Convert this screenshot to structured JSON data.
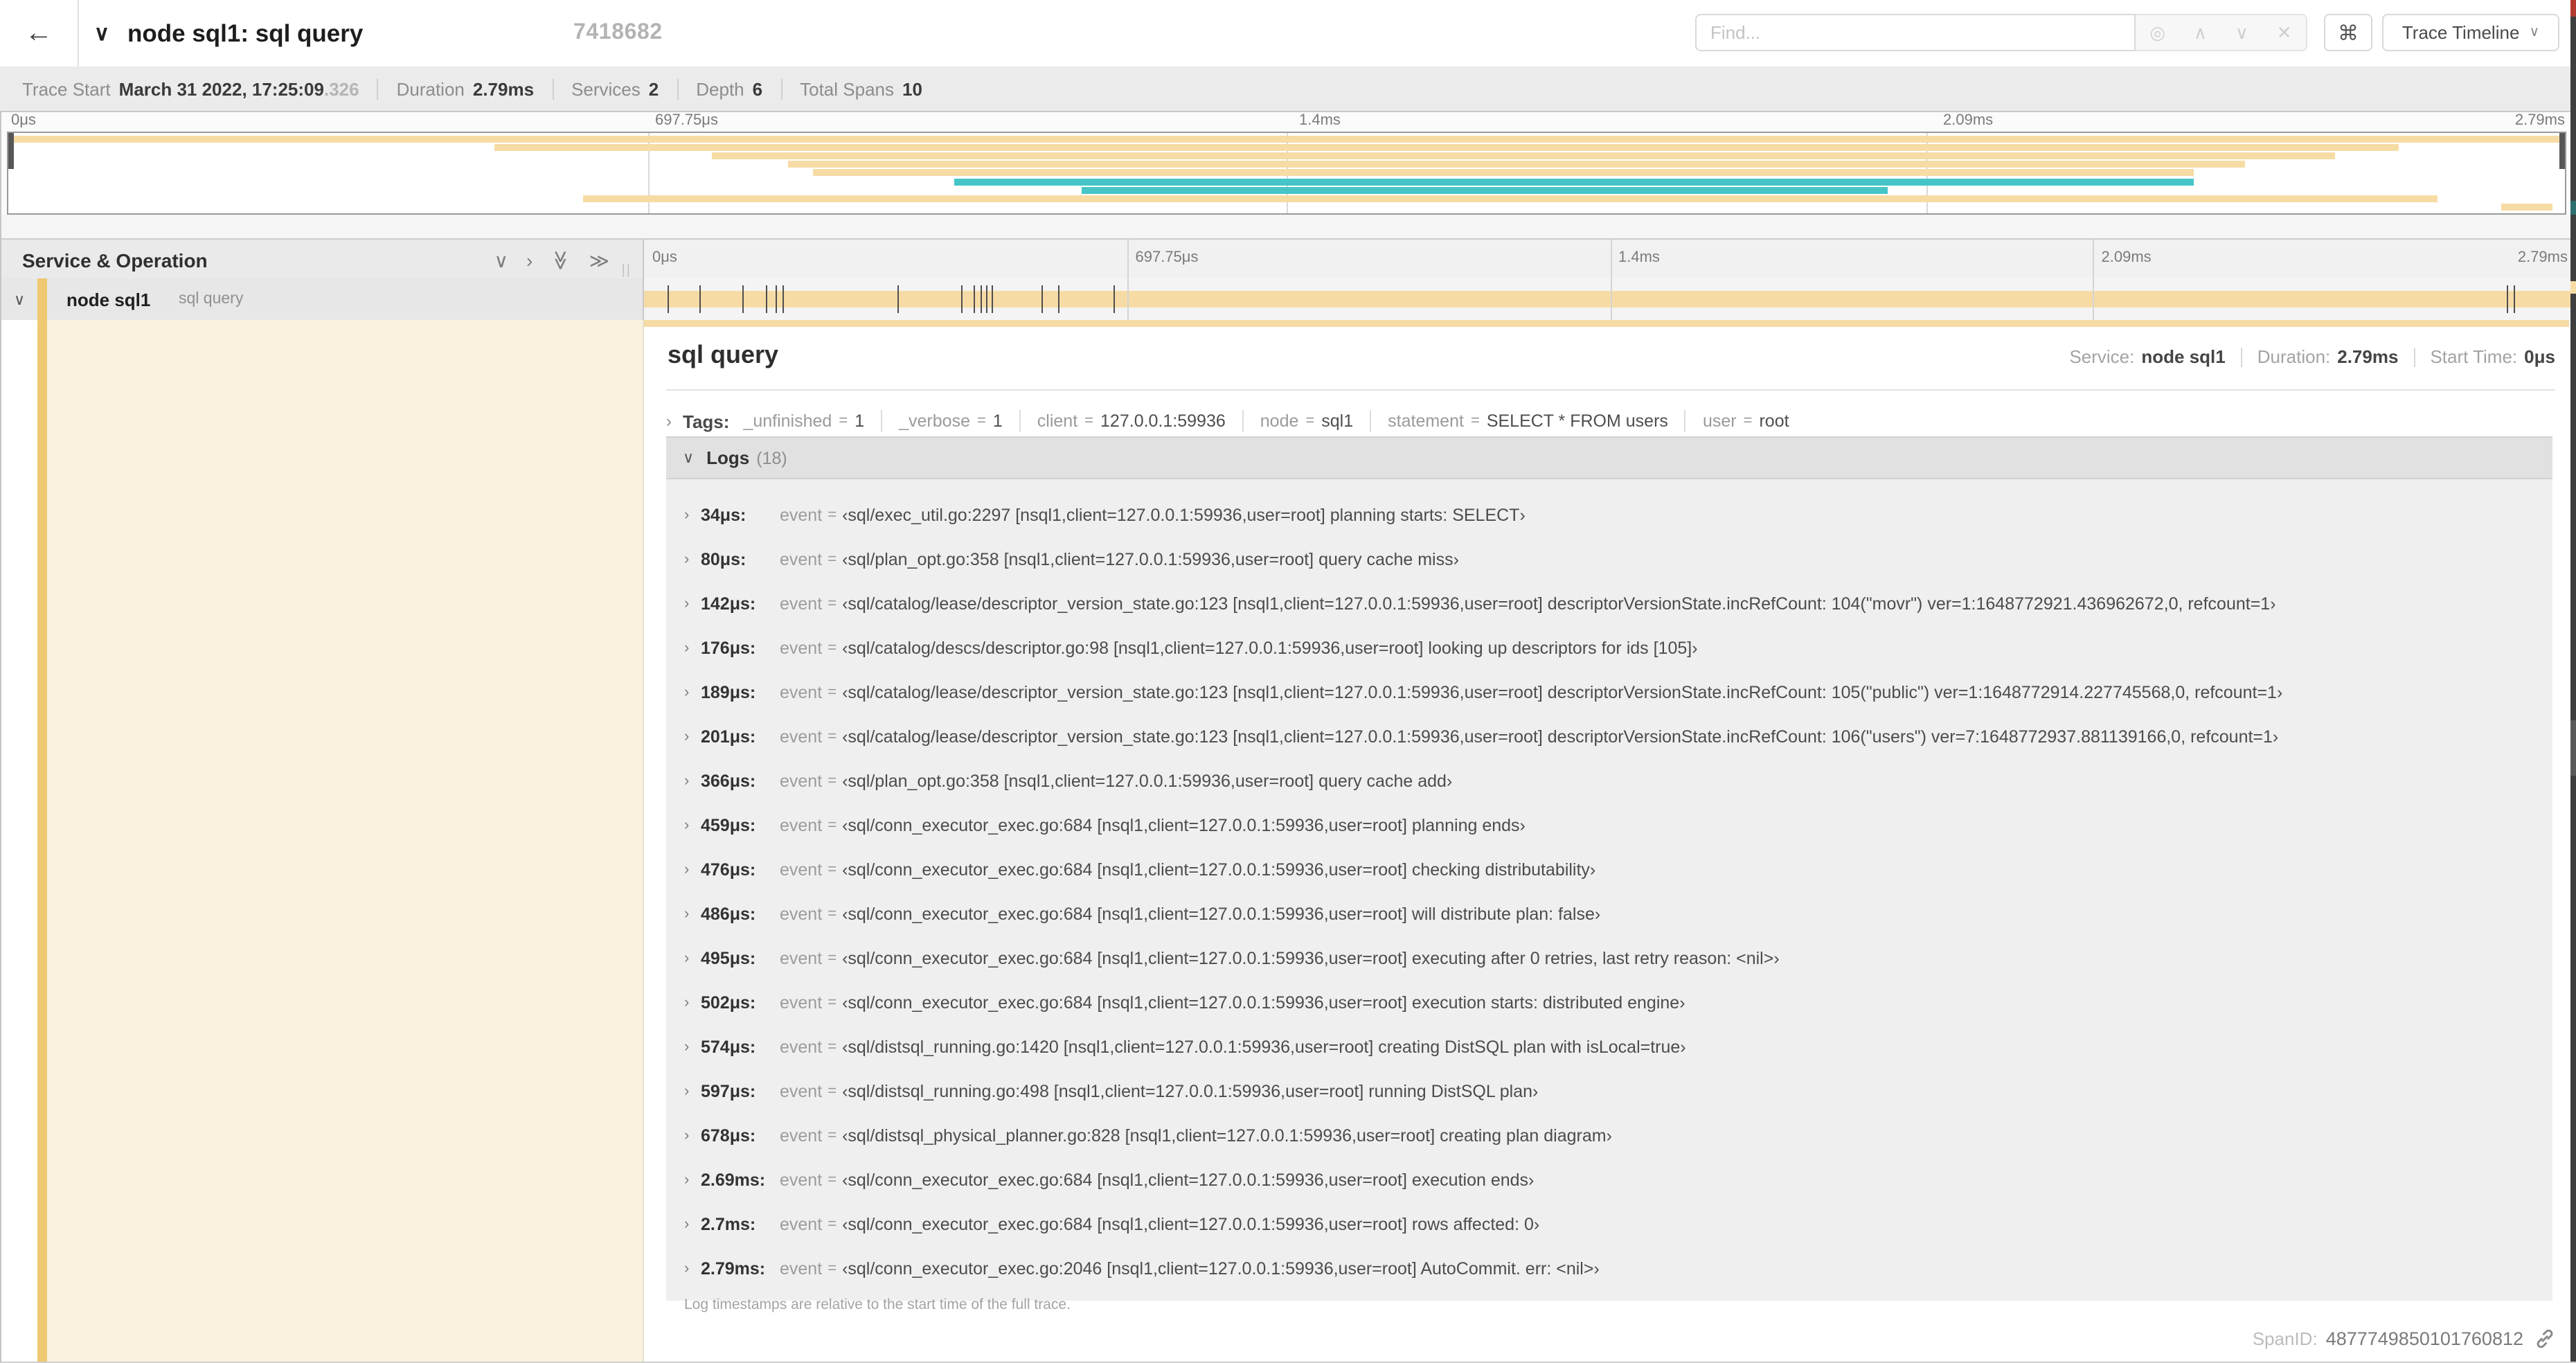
{
  "palette": {
    "span_color": "#F6DCA4",
    "span_alt_color": "#46C5C7",
    "accent_strip": "#EFC873",
    "detail_left_bg": "#FAF2DF"
  },
  "header": {
    "back_arrow": "←",
    "collapse_chevron": "∨",
    "title": "node sql1: sql query",
    "trace_id": "7418682",
    "find_placeholder": "Find...",
    "find_icons": [
      "◎",
      "∧",
      "∨",
      "✕"
    ],
    "shortcut_key": "⌘",
    "view_select_label": "Trace Timeline",
    "view_select_caret": "∨"
  },
  "summary": {
    "items": [
      {
        "label": "Trace Start",
        "value": "March 31 2022, 17:25:09",
        "suffix": ".326"
      },
      {
        "label": "Duration",
        "value": "2.79ms"
      },
      {
        "label": "Services",
        "value": "2"
      },
      {
        "label": "Depth",
        "value": "6"
      },
      {
        "label": "Total Spans",
        "value": "10"
      }
    ]
  },
  "minimap": {
    "bars": [
      {
        "start": 0.1,
        "end": 99.9,
        "color": "tan"
      },
      {
        "start": 19,
        "end": 93.5,
        "color": "tan"
      },
      {
        "start": 27.5,
        "end": 91,
        "color": "tan"
      },
      {
        "start": 30.5,
        "end": 87.5,
        "color": "tan"
      },
      {
        "start": 31.5,
        "end": 85.5,
        "color": "tan"
      },
      {
        "start": 37,
        "end": 85.5,
        "color": "teal"
      },
      {
        "start": 42,
        "end": 73.5,
        "color": "teal"
      },
      {
        "start": 22.5,
        "end": 95,
        "color": "tan"
      },
      {
        "start": 97.5,
        "end": 99.5,
        "color": "tan"
      }
    ]
  },
  "timeline": {
    "ticks": [
      {
        "label": "0μs",
        "pos": 0
      },
      {
        "label": "697.75μs",
        "pos": 25
      },
      {
        "label": "1.4ms",
        "pos": 50
      },
      {
        "label": "2.09ms",
        "pos": 75
      },
      {
        "label": "2.79ms",
        "pos": 100
      }
    ],
    "col_header": "Service & Operation",
    "controls": {
      "collapse_one": "∨",
      "expand_one": "›",
      "collapse_all": "≫",
      "expand_all": "≫",
      "resizer": "||"
    },
    "row": {
      "chevron": "∨",
      "service": "node sql1",
      "operation": "sql query",
      "marker_percents": [
        1.22,
        2.87,
        5.09,
        6.31,
        6.78,
        7.2,
        13.12,
        16.45,
        17.06,
        17.42,
        17.74,
        18.0,
        20.57,
        21.4,
        24.3,
        96.4,
        96.8,
        99.8
      ]
    }
  },
  "detail": {
    "title": "sql query",
    "service_label": "Service:",
    "service": "node sql1",
    "duration_label": "Duration:",
    "duration": "2.79ms",
    "start_label": "Start Time:",
    "start": "0μs",
    "tags_chevron": "›",
    "tags_label": "Tags:",
    "tags": [
      {
        "key": "_unfinished",
        "value": "1"
      },
      {
        "key": "_verbose",
        "value": "1"
      },
      {
        "key": "client",
        "value": "127.0.0.1:59936"
      },
      {
        "key": "node",
        "value": "sql1"
      },
      {
        "key": "statement",
        "value": "SELECT * FROM users"
      },
      {
        "key": "user",
        "value": "root"
      }
    ],
    "logs_chevron": "∨",
    "logs_label": "Logs",
    "logs_count": "(18)",
    "log_chevron": "›",
    "log_field_label": "event",
    "log_eq": "=",
    "logs": [
      {
        "time": "34μs:",
        "value": "‹sql/exec_util.go:2297 [nsql1,client=127.0.0.1:59936,user=root] planning starts: SELECT›"
      },
      {
        "time": "80μs:",
        "value": "‹sql/plan_opt.go:358 [nsql1,client=127.0.0.1:59936,user=root] query cache miss›"
      },
      {
        "time": "142μs:",
        "value": "‹sql/catalog/lease/descriptor_version_state.go:123 [nsql1,client=127.0.0.1:59936,user=root] descriptorVersionState.incRefCount: 104(\"movr\") ver=1:1648772921.436962672,0, refcount=1›"
      },
      {
        "time": "176μs:",
        "value": "‹sql/catalog/descs/descriptor.go:98 [nsql1,client=127.0.0.1:59936,user=root] looking up descriptors for ids [105]›"
      },
      {
        "time": "189μs:",
        "value": "‹sql/catalog/lease/descriptor_version_state.go:123 [nsql1,client=127.0.0.1:59936,user=root] descriptorVersionState.incRefCount: 105(\"public\") ver=1:1648772914.227745568,0, refcount=1›"
      },
      {
        "time": "201μs:",
        "value": "‹sql/catalog/lease/descriptor_version_state.go:123 [nsql1,client=127.0.0.1:59936,user=root] descriptorVersionState.incRefCount: 106(\"users\") ver=7:1648772937.881139166,0, refcount=1›"
      },
      {
        "time": "366μs:",
        "value": "‹sql/plan_opt.go:358 [nsql1,client=127.0.0.1:59936,user=root] query cache add›"
      },
      {
        "time": "459μs:",
        "value": "‹sql/conn_executor_exec.go:684 [nsql1,client=127.0.0.1:59936,user=root] planning ends›"
      },
      {
        "time": "476μs:",
        "value": "‹sql/conn_executor_exec.go:684 [nsql1,client=127.0.0.1:59936,user=root] checking distributability›"
      },
      {
        "time": "486μs:",
        "value": "‹sql/conn_executor_exec.go:684 [nsql1,client=127.0.0.1:59936,user=root] will distribute plan: false›"
      },
      {
        "time": "495μs:",
        "value": "‹sql/conn_executor_exec.go:684 [nsql1,client=127.0.0.1:59936,user=root] executing after 0 retries, last retry reason: <nil>›"
      },
      {
        "time": "502μs:",
        "value": "‹sql/conn_executor_exec.go:684 [nsql1,client=127.0.0.1:59936,user=root] execution starts: distributed engine›"
      },
      {
        "time": "574μs:",
        "value": "‹sql/distsql_running.go:1420 [nsql1,client=127.0.0.1:59936,user=root] creating DistSQL plan with isLocal=true›"
      },
      {
        "time": "597μs:",
        "value": "‹sql/distsql_running.go:498 [nsql1,client=127.0.0.1:59936,user=root] running DistSQL plan›"
      },
      {
        "time": "678μs:",
        "value": "‹sql/distsql_physical_planner.go:828 [nsql1,client=127.0.0.1:59936,user=root] creating plan diagram›"
      },
      {
        "time": "2.69ms:",
        "value": "‹sql/conn_executor_exec.go:684 [nsql1,client=127.0.0.1:59936,user=root] execution ends›"
      },
      {
        "time": "2.7ms:",
        "value": "‹sql/conn_executor_exec.go:684 [nsql1,client=127.0.0.1:59936,user=root] rows affected: 0›"
      },
      {
        "time": "2.79ms:",
        "value": "‹sql/conn_executor_exec.go:2046 [nsql1,client=127.0.0.1:59936,user=root] AutoCommit. err: <nil>›"
      }
    ],
    "logs_note": "Log timestamps are relative to the start time of the full trace.",
    "spanid_label": "SpanID:",
    "spanid_value": "4877749850101760812"
  }
}
